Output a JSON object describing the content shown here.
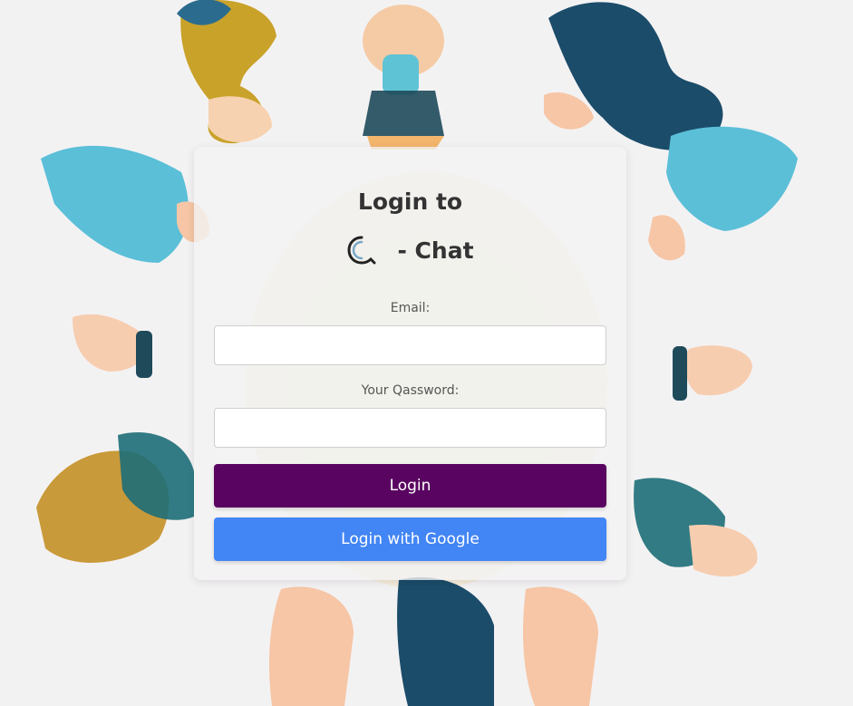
{
  "theme": {
    "login_button_color": "#5a0461",
    "google_button_color": "#4285f4"
  },
  "login_card": {
    "title": "Login to",
    "brand_logo_icon": "q-swirl-logo-icon",
    "brand_suffix": "- Chat",
    "email_label": "Email:",
    "email_value": "",
    "password_label": "Your Qassword:",
    "password_value": "",
    "login_button_label": "Login",
    "google_button_label": "Login with Google"
  }
}
